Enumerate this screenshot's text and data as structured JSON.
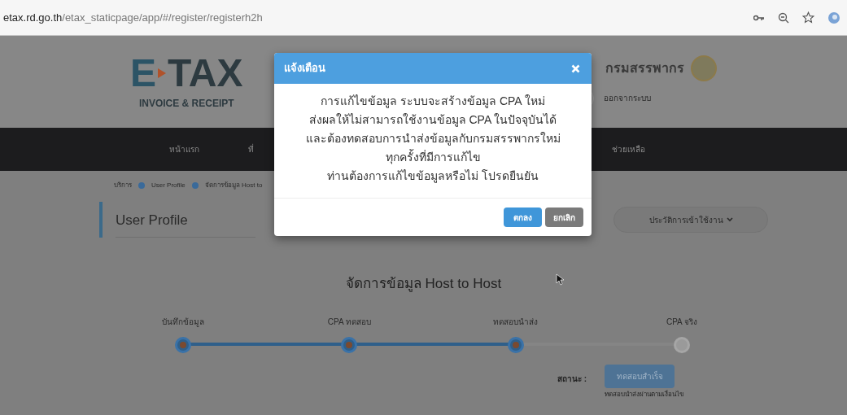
{
  "browser": {
    "url": "**etax.rd.go.th**/etax_staticpage/app/#/register/registerh2h"
  },
  "header": {
    "logo": {
      "mark": "E",
      "word": "TAX",
      "tagline": "INVOICE & RECEIPT"
    },
    "department": "กรมสรรพากร",
    "logout": "ออกจากระบบ"
  },
  "nav": [
    {
      "label": "หน้าแรก"
    },
    {
      "label": "ที่"
    },
    {
      "label": "ช่วยเหลือ"
    }
  ],
  "breadcrumb": [
    "บริการ",
    "User Profile",
    "จัดการข้อมูล Host to"
  ],
  "page_title": "User Profile",
  "history_button": "ประวัติการเข้าใช้งาน",
  "section_title": "จัดการข้อมูล Host to Host",
  "steps": [
    {
      "label": "บันทึกข้อมูล",
      "done": true
    },
    {
      "label": "CPA ทดสอบ",
      "done": true
    },
    {
      "label": "ทดสอบนำส่ง",
      "done": true
    },
    {
      "label": "CPA จริง",
      "done": false
    }
  ],
  "status": {
    "label": "สถานะ :",
    "button": "ทดสอบสำเร็จ",
    "note": "ทดสอบนำส่งผ่านตามเงื่อนไข"
  },
  "dialog": {
    "title": "แจ้งเตือน",
    "lines": [
      "การแก้ไขข้อมูล ระบบจะสร้างข้อมูล CPA ใหม่",
      "ส่งผลให้ไม่สามารถใช้งานข้อมูล CPA ในปัจจุบันได้",
      "และต้องทดสอบการนำส่งข้อมูลกับกรมสรรพากรใหม่",
      "ทุกครั้งที่มีการแก้ไข",
      "ท่านต้องการแก้ไขข้อมูลหรือไม่ โปรดยืนยัน"
    ],
    "buttons": [
      {
        "label": "ตกลง",
        "kind": "primary"
      },
      {
        "label": "ยกเลิก",
        "kind": "secondary"
      }
    ]
  }
}
